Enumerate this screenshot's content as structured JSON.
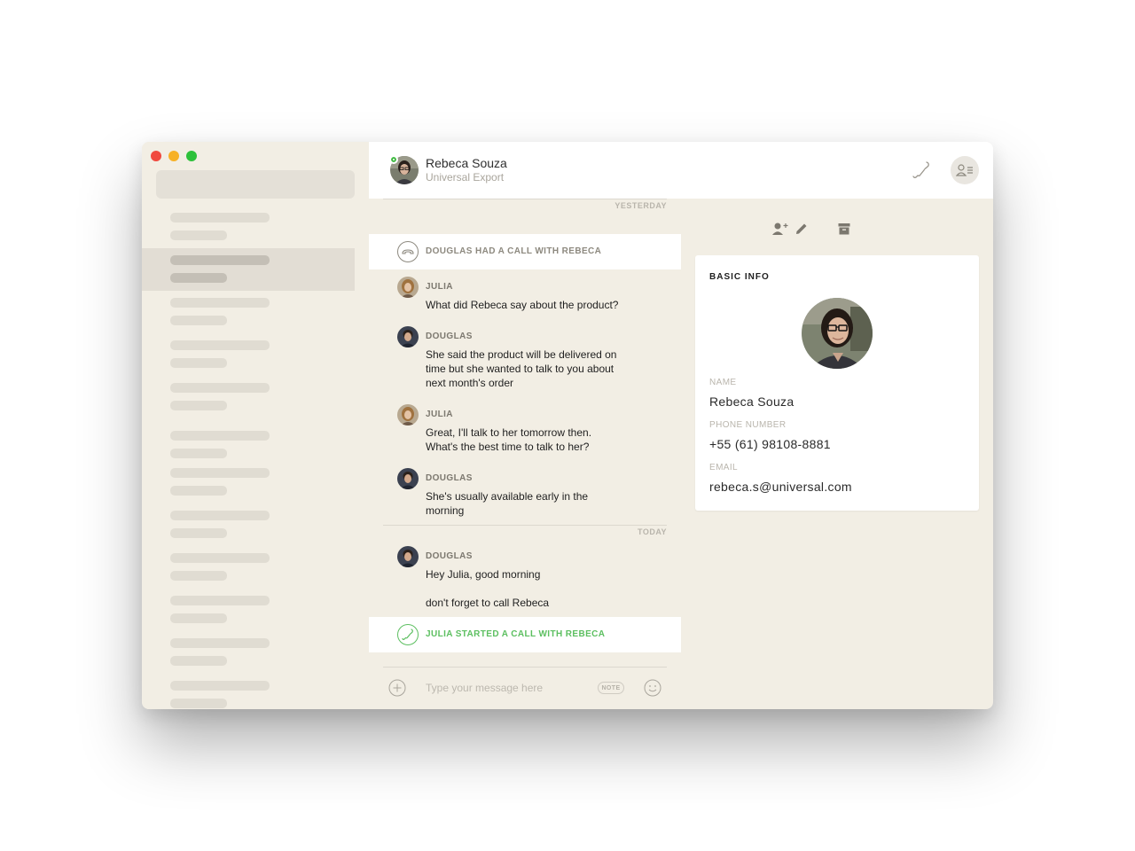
{
  "header": {
    "name": "Rebeca Souza",
    "company": "Universal Export"
  },
  "chat": {
    "dividers": {
      "yesterday": "YESTERDAY",
      "today": "TODAY"
    },
    "events": {
      "missed_call": "DOUGLAS HAD A CALL WITH REBECA",
      "started_call": "JULIA STARTED A CALL WITH REBECA"
    },
    "messages": [
      {
        "author": "JULIA",
        "lines": [
          "What did Rebeca say about the product?"
        ]
      },
      {
        "author": "DOUGLAS",
        "lines": [
          "She said the product will be delivered on",
          "time but she wanted to talk to you about",
          "next month's order"
        ]
      },
      {
        "author": "JULIA",
        "lines": [
          "Great, I'll talk to her tomorrow then.",
          "What's the best time to talk to her?"
        ]
      },
      {
        "author": "DOUGLAS",
        "lines": [
          "She's usually available early in the",
          "morning"
        ]
      },
      {
        "author": "DOUGLAS",
        "lines": [
          "Hey Julia, good morning",
          "don't forget to call Rebeca"
        ]
      }
    ]
  },
  "composer": {
    "placeholder": "Type your message here",
    "note_label": "NOTE"
  },
  "panel": {
    "card_title": "BASIC INFO",
    "name_label": "NAME",
    "name_value": "Rebeca Souza",
    "phone_label": "PHONE NUMBER",
    "phone_value": "+55 (61) 98108-8881",
    "email_label": "EMAIL",
    "email_value": "rebeca.s@universal.com"
  },
  "colors": {
    "background": "#f2eee4",
    "call_green": "#5cbf60",
    "event_gray": "#8d897f"
  },
  "icons": [
    "phone-icon",
    "contact-card-icon",
    "add-user-icon",
    "edit-icon",
    "archive-icon",
    "hangup-icon",
    "call-started-icon",
    "add-icon",
    "emoji-icon"
  ]
}
